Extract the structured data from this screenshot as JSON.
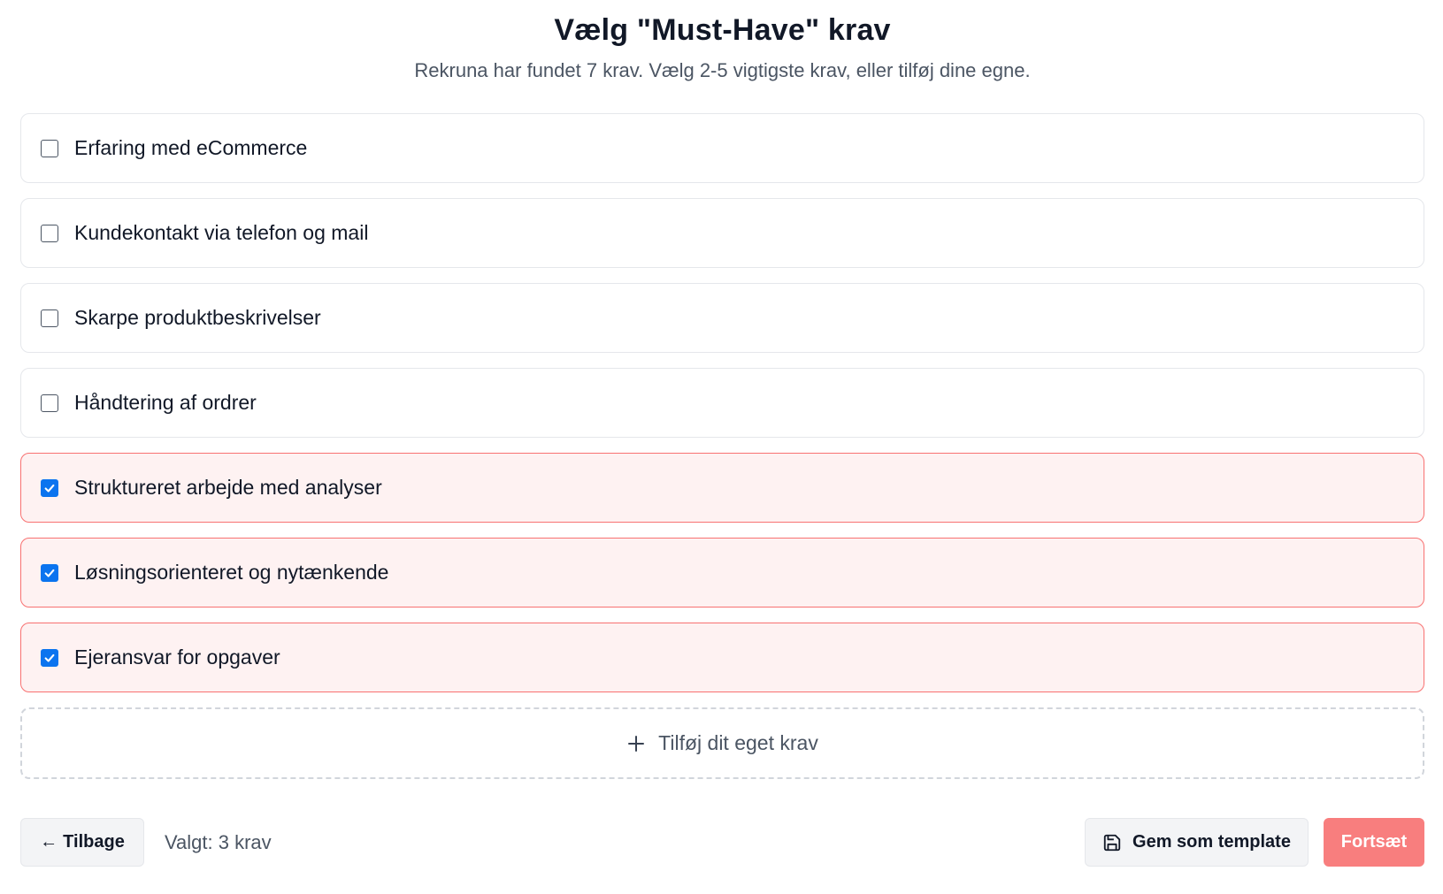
{
  "header": {
    "title": "Vælg \"Must-Have\" krav",
    "subtitle": "Rekruna har fundet 7 krav. Vælg 2-5 vigtigste krav, eller tilføj dine egne."
  },
  "requirements": [
    {
      "label": "Erfaring med eCommerce",
      "checked": false
    },
    {
      "label": "Kundekontakt via telefon og mail",
      "checked": false
    },
    {
      "label": "Skarpe produktbeskrivelser",
      "checked": false
    },
    {
      "label": "Håndtering af ordrer",
      "checked": false
    },
    {
      "label": "Struktureret arbejde med analyser",
      "checked": true
    },
    {
      "label": "Løsningsorienteret og nytænkende",
      "checked": true
    },
    {
      "label": "Ejeransvar for opgaver",
      "checked": true
    }
  ],
  "add_requirement": {
    "label": "Tilføj dit eget krav",
    "icon": "plus-icon"
  },
  "footer": {
    "back_label": "Tilbage",
    "back_icon": "arrow-left-icon",
    "selected_text": "Valgt: 3 krav",
    "save_template_label": "Gem som template",
    "save_template_icon": "save-icon",
    "continue_label": "Fortsæt"
  },
  "colors": {
    "accent": "#f87171",
    "checked_background": "#fef2f2",
    "checkbox_checked": "#0b74ef"
  }
}
